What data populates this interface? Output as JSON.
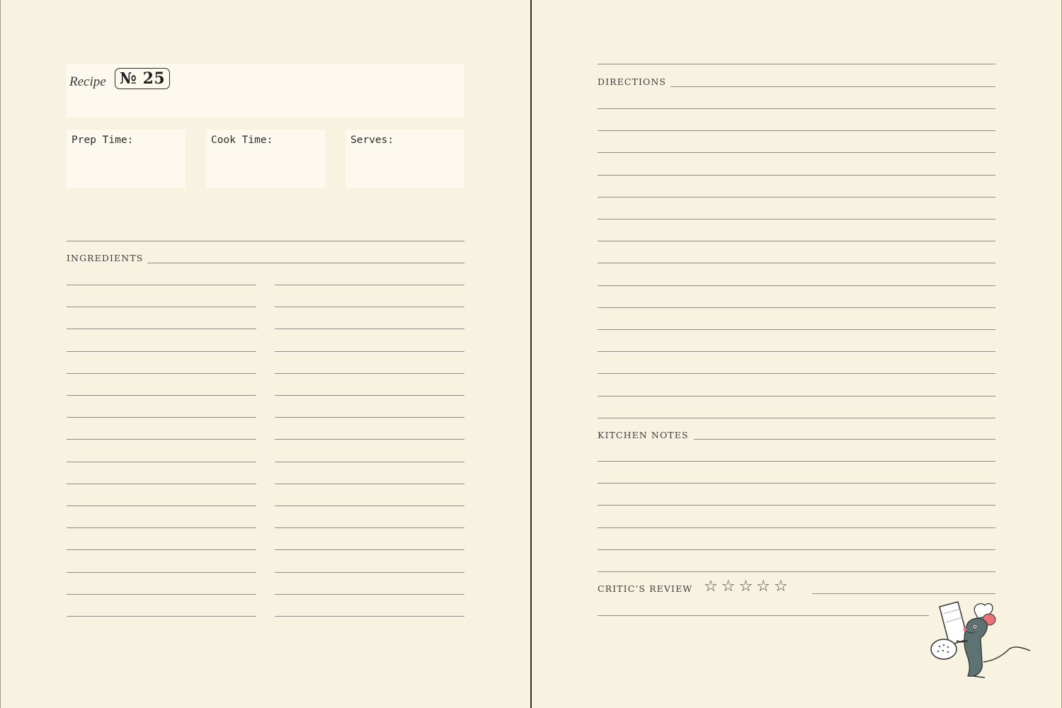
{
  "recipe": {
    "word": "Recipe",
    "number_label": "№ 25"
  },
  "fields": {
    "prep_time": "Prep Time:",
    "cook_time": "Cook Time:",
    "serves": "Serves:"
  },
  "sections": {
    "ingredients": "INGREDIENTS",
    "directions": "DIRECTIONS",
    "kitchen_notes": "KITCHEN NOTES",
    "critics_review": "CRITIC’S REVIEW"
  },
  "rating": {
    "stars_total": 5,
    "stars_filled": 0
  },
  "icons": {
    "star": "star-outline-icon",
    "illustration": "chef-rat-with-salt-shaker-illustration"
  },
  "colors": {
    "paper": "#f8f2e1",
    "box": "#fdf9ef",
    "rule": "#8f8f86",
    "ink": "#3d3d3d"
  }
}
